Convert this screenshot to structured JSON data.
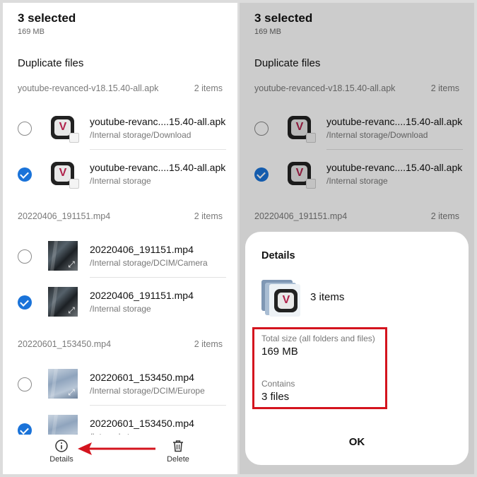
{
  "header": {
    "title": "3 selected",
    "size": "169 MB"
  },
  "section_title": "Duplicate files",
  "groups": [
    {
      "name": "youtube-revanced-v18.15.40-all.apk",
      "count": "2 items",
      "files": [
        {
          "name": "youtube-revanc....15.40-all.apk",
          "path": "/Internal storage/Download",
          "checked": false
        },
        {
          "name": "youtube-revanc....15.40-all.apk",
          "path": "/Internal storage",
          "checked": true
        }
      ]
    },
    {
      "name": "20220406_191151.mp4",
      "count": "2 items",
      "files": [
        {
          "name": "20220406_191151.mp4",
          "path": "/Internal storage/DCIM/Camera",
          "checked": false
        },
        {
          "name": "20220406_191151.mp4",
          "path": "/Internal storage",
          "checked": true
        }
      ]
    },
    {
      "name": "20220601_153450.mp4",
      "count": "2 items",
      "files": [
        {
          "name": "20220601_153450.mp4",
          "path": "/Internal storage/DCIM/Europe",
          "checked": false
        },
        {
          "name": "20220601_153450.mp4",
          "path": "/Internal storage",
          "checked": true
        }
      ]
    }
  ],
  "bottom_bar": {
    "details_label": "Details",
    "delete_label": "Delete"
  },
  "details_sheet": {
    "title": "Details",
    "items_count": "3 items",
    "total_size_label": "Total size (all folders and files)",
    "total_size_value": "169 MB",
    "contains_label": "Contains",
    "contains_value": "3 files",
    "ok_label": "OK"
  },
  "icons": {
    "apk": "youtube-revanced-app-icon",
    "video": "video-thumbnail",
    "info": "info-icon",
    "delete": "trash-icon"
  },
  "colors": {
    "accent": "#1a73d9",
    "highlight": "#d4141e",
    "text_secondary": "#777777"
  }
}
